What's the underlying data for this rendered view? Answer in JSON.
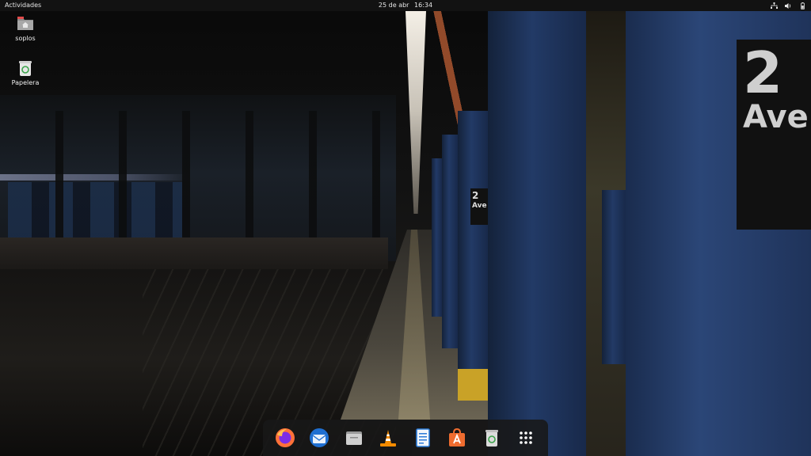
{
  "topbar": {
    "activities_label": "Actividades",
    "date": "25 de abr",
    "time": "16:34",
    "tray": {
      "network_icon": "network-icon",
      "volume_icon": "volume-icon",
      "battery_icon": "battery-icon"
    }
  },
  "desktop": {
    "icons": [
      {
        "label": "soplos",
        "icon": "home-folder-icon"
      },
      {
        "label": "Papelera",
        "icon": "trash-icon"
      }
    ]
  },
  "wallpaper": {
    "sign_large_line1": "2",
    "sign_large_line2": "Ave",
    "sign_small_line1": "2",
    "sign_small_line2": "Ave"
  },
  "dock": {
    "items": [
      {
        "name": "firefox",
        "icon": "firefox-icon",
        "color": "#ff7139"
      },
      {
        "name": "thunderbird",
        "icon": "mail-icon",
        "color": "#2a7de1"
      },
      {
        "name": "files",
        "icon": "folder-icon",
        "color": "#bdbdbd"
      },
      {
        "name": "vlc",
        "icon": "vlc-cone-icon",
        "color": "#f48b00"
      },
      {
        "name": "writer",
        "icon": "document-icon",
        "color": "#2b7bd8"
      },
      {
        "name": "software",
        "icon": "store-icon",
        "color": "#ef6c2f"
      },
      {
        "name": "trash",
        "icon": "trash-icon",
        "color": "#d9d9d9"
      },
      {
        "name": "app-grid",
        "icon": "grid-icon",
        "color": "#ffffff"
      }
    ]
  }
}
